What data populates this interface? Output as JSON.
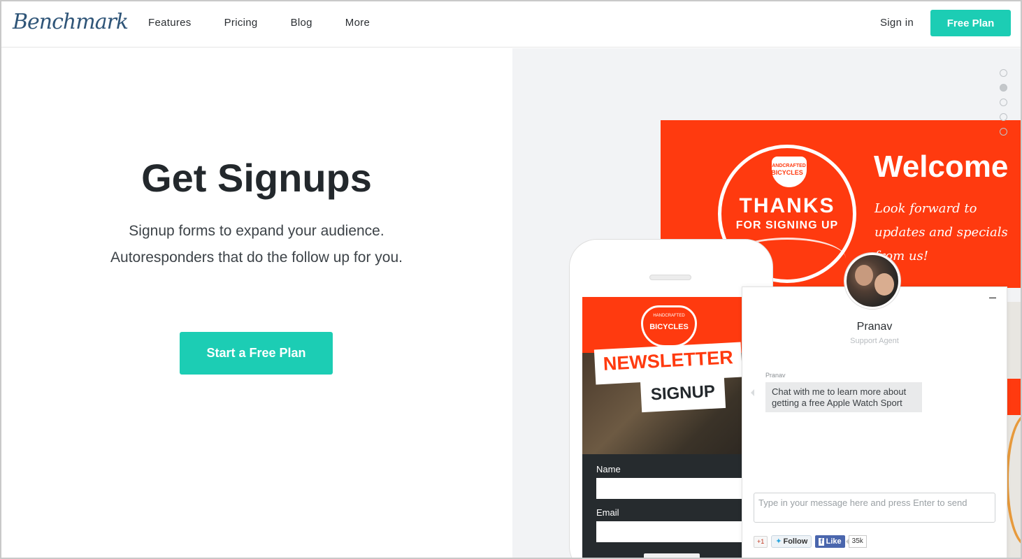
{
  "header": {
    "logo": "Benchmark",
    "nav": [
      "Features",
      "Pricing",
      "Blog",
      "More"
    ],
    "sign_in": "Sign in",
    "free_plan": "Free Plan"
  },
  "hero": {
    "title": "Get Signups",
    "subtitle": "Signup forms to expand your audience. Autoresponders that do the follow up for you.",
    "cta": "Start a Free Plan"
  },
  "carousel": {
    "total_dots": 5,
    "active_index": 1
  },
  "banner": {
    "badge_small": "HANDCRAFTED",
    "badge_bicycles": "BICYCLES",
    "badge_thanks": "THANKS",
    "badge_for": "FOR SIGNING UP",
    "welcome": "Welcome",
    "welcome_sub": "Look forward to updates and specials from us!"
  },
  "phone": {
    "handcrafted": "HANDCRAFTED",
    "bicycles": "BICYCLES",
    "newsletter": "NEWSLETTER",
    "signup": "SIGNUP",
    "name_label": "Name",
    "email_label": "Email"
  },
  "chat": {
    "minimize": "–",
    "agent_name": "Pranav",
    "agent_role": "Support Agent",
    "msg_author": "Pranav",
    "message": "Chat with me to learn more about getting a free Apple Watch Sport",
    "input_placeholder": "Type in your message here and press Enter to send",
    "gplus": "+1",
    "twitter_follow": "Follow",
    "fb_like": "Like",
    "fb_count": "35k"
  },
  "colors": {
    "accent": "#1ccdb4",
    "banner": "#ff3a0f"
  }
}
